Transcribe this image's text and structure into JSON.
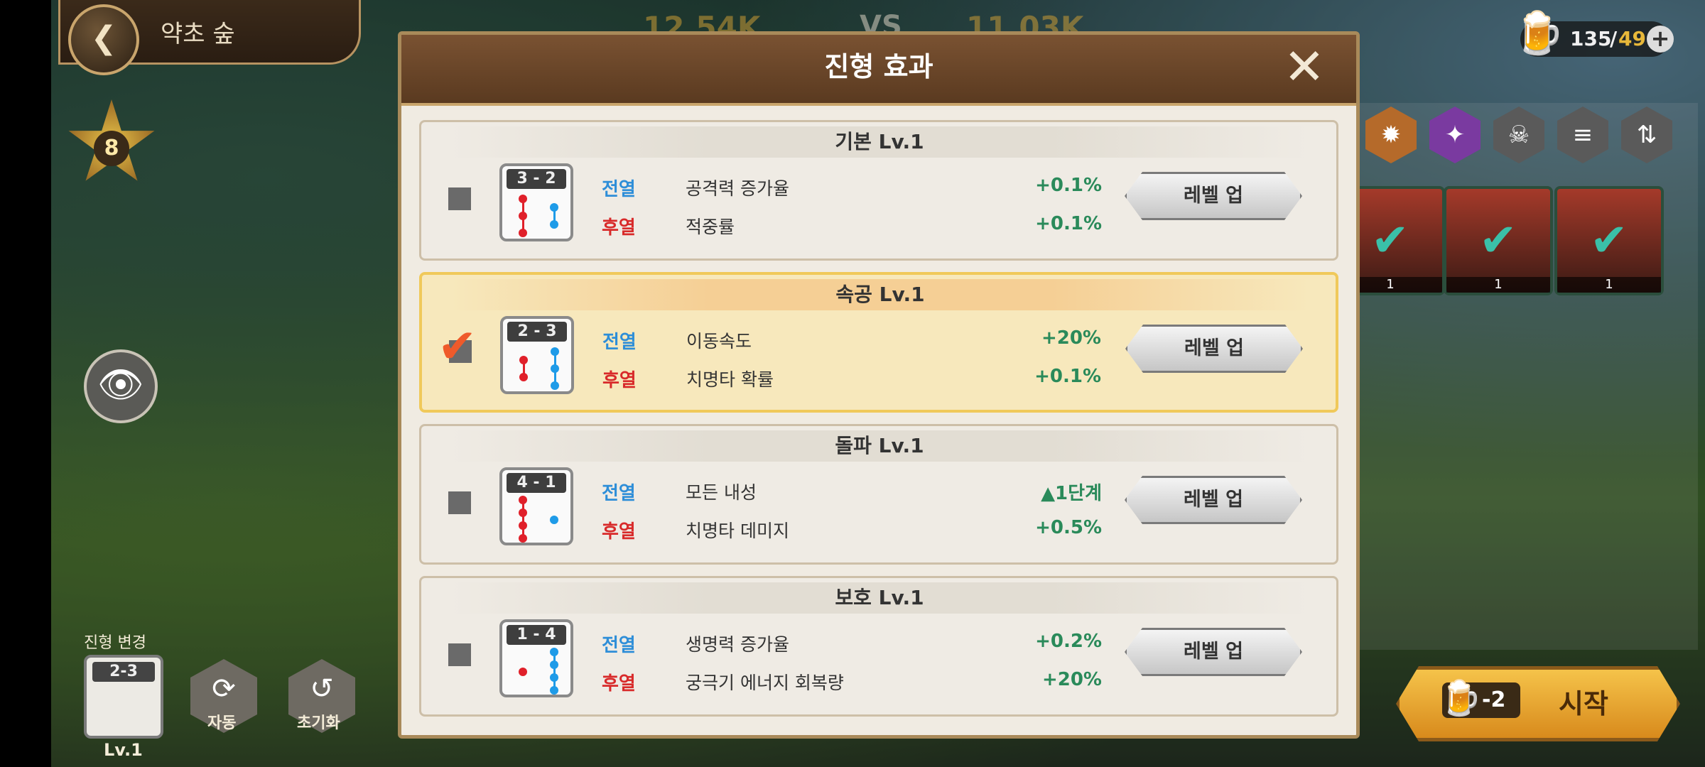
{
  "location": {
    "name": "약초 숲"
  },
  "battle": {
    "power_left": "12.54K",
    "vs": "VS",
    "power_right": "11.03K"
  },
  "star_level": "8",
  "stamina": {
    "current": "135",
    "separator": "/",
    "max": "49",
    "plus": "+"
  },
  "formation_panel": {
    "label": "진형 변경",
    "card": "2-3",
    "level": "Lv.1"
  },
  "left_buttons": [
    {
      "label": "자동"
    },
    {
      "label": "초기화"
    }
  ],
  "heroes": [
    {
      "level": "1"
    },
    {
      "level": "1"
    },
    {
      "level": "1"
    }
  ],
  "start_button": {
    "cost": "-2",
    "label": "시작"
  },
  "modal": {
    "title": "진형 효과",
    "close": "✕",
    "rows": [
      {
        "header": "기본 Lv.1",
        "formation": "3 - 2",
        "selected": false,
        "front_label": "전열",
        "front_stat": "공격력 증가율",
        "front_value": "+0.1%",
        "back_label": "후열",
        "back_stat": "적중률",
        "back_value": "+0.1%",
        "button": "레벨 업"
      },
      {
        "header": "속공 Lv.1",
        "formation": "2 - 3",
        "selected": true,
        "front_label": "전열",
        "front_stat": "이동속도",
        "front_value": "+20%",
        "back_label": "후열",
        "back_stat": "치명타 확률",
        "back_value": "+0.1%",
        "button": "레벨 업"
      },
      {
        "header": "돌파 Lv.1",
        "formation": "4 - 1",
        "selected": false,
        "front_label": "전열",
        "front_stat": "모든 내성",
        "front_value": "▲1단계",
        "back_label": "후열",
        "back_stat": "치명타 데미지",
        "back_value": "+0.5%",
        "button": "레벨 업"
      },
      {
        "header": "보호 Lv.1",
        "formation": "1 - 4",
        "selected": false,
        "front_label": "전열",
        "front_stat": "생명력 증가율",
        "front_value": "+0.2%",
        "back_label": "후열",
        "back_stat": "궁극기 에너지 회복량",
        "back_value": "+20%",
        "button": "레벨 업"
      }
    ]
  },
  "colors": {
    "front": "#2e8ed8",
    "back": "#d82a2a",
    "value": "#2a8a5a",
    "accent": "#f0c95a"
  }
}
